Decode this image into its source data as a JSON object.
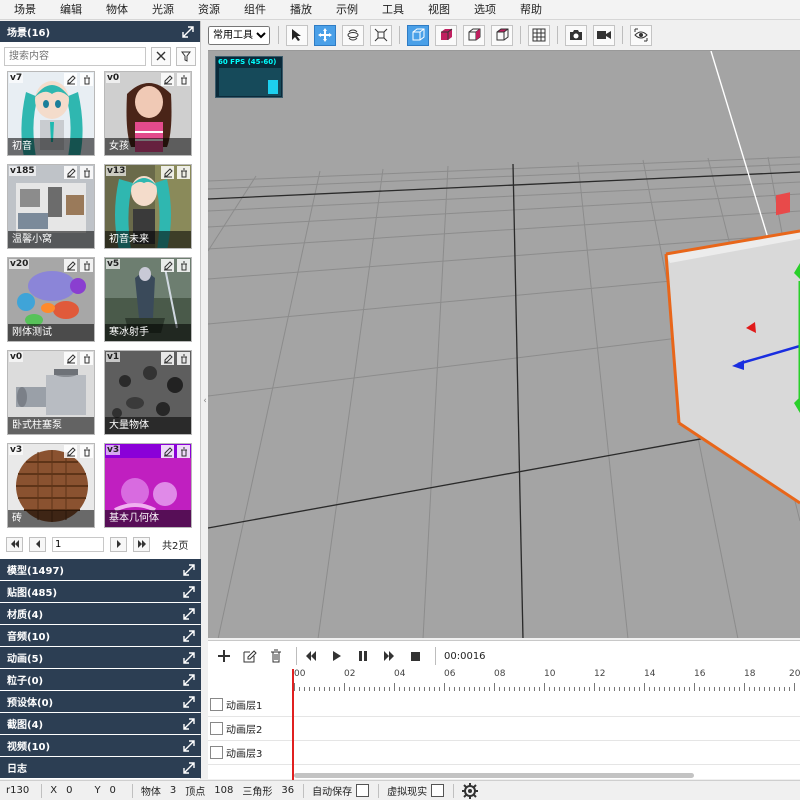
{
  "menubar": {
    "items": [
      "场景",
      "编辑",
      "物体",
      "光源",
      "资源",
      "组件",
      "播放",
      "示例",
      "工具",
      "视图",
      "选项",
      "帮助"
    ]
  },
  "scene_panel": {
    "title": "场景(16)",
    "search_placeholder": "搜索内容",
    "cards": [
      {
        "version": "v7",
        "name": "初音"
      },
      {
        "version": "v0",
        "name": "女孩"
      },
      {
        "version": "v185",
        "name": "温馨小窝"
      },
      {
        "version": "v13",
        "name": "初音未来"
      },
      {
        "version": "v20",
        "name": "刚体测试"
      },
      {
        "version": "v5",
        "name": "寒冰射手"
      },
      {
        "version": "v0",
        "name": "卧式柱塞泵"
      },
      {
        "version": "v1",
        "name": "大量物体"
      },
      {
        "version": "v3",
        "name": "砖"
      },
      {
        "version": "v3",
        "name": "基本几何体"
      }
    ],
    "pagination": {
      "current_page": "1",
      "total_label": "共2页"
    }
  },
  "collapsed_panels": [
    "模型(1497)",
    "贴图(485)",
    "材质(4)",
    "音频(10)",
    "动画(5)",
    "粒子(0)",
    "预设体(0)",
    "截图(4)",
    "视频(10)",
    "日志"
  ],
  "toolbar": {
    "mode_select": "常用工具"
  },
  "viewport": {
    "fps_label": "60 FPS (45-60)",
    "fps_level": 0.55
  },
  "timeline": {
    "time": "00:0016",
    "ruler_labels": [
      "00",
      "02",
      "04",
      "06",
      "08",
      "10",
      "12",
      "14",
      "16",
      "18",
      "20"
    ],
    "layers": [
      "动画层1",
      "动画层2",
      "动画层3"
    ]
  },
  "statusbar": {
    "renderer": "r130",
    "x_label": "X",
    "x_value": "0",
    "y_label": "Y",
    "y_value": "0",
    "objects_label": "物体",
    "objects_value": "3",
    "vertices_label": "顶点",
    "vertices_value": "108",
    "triangles_label": "三角形",
    "triangles_value": "36",
    "autosave_label": "自动保存",
    "vr_label": "虚拟现实"
  },
  "colors": {
    "panel_header": "#2c3e53",
    "accent": "#4aa0e8",
    "selection_box": "#e8661a",
    "viewport_bg": "#a4a4a4"
  }
}
